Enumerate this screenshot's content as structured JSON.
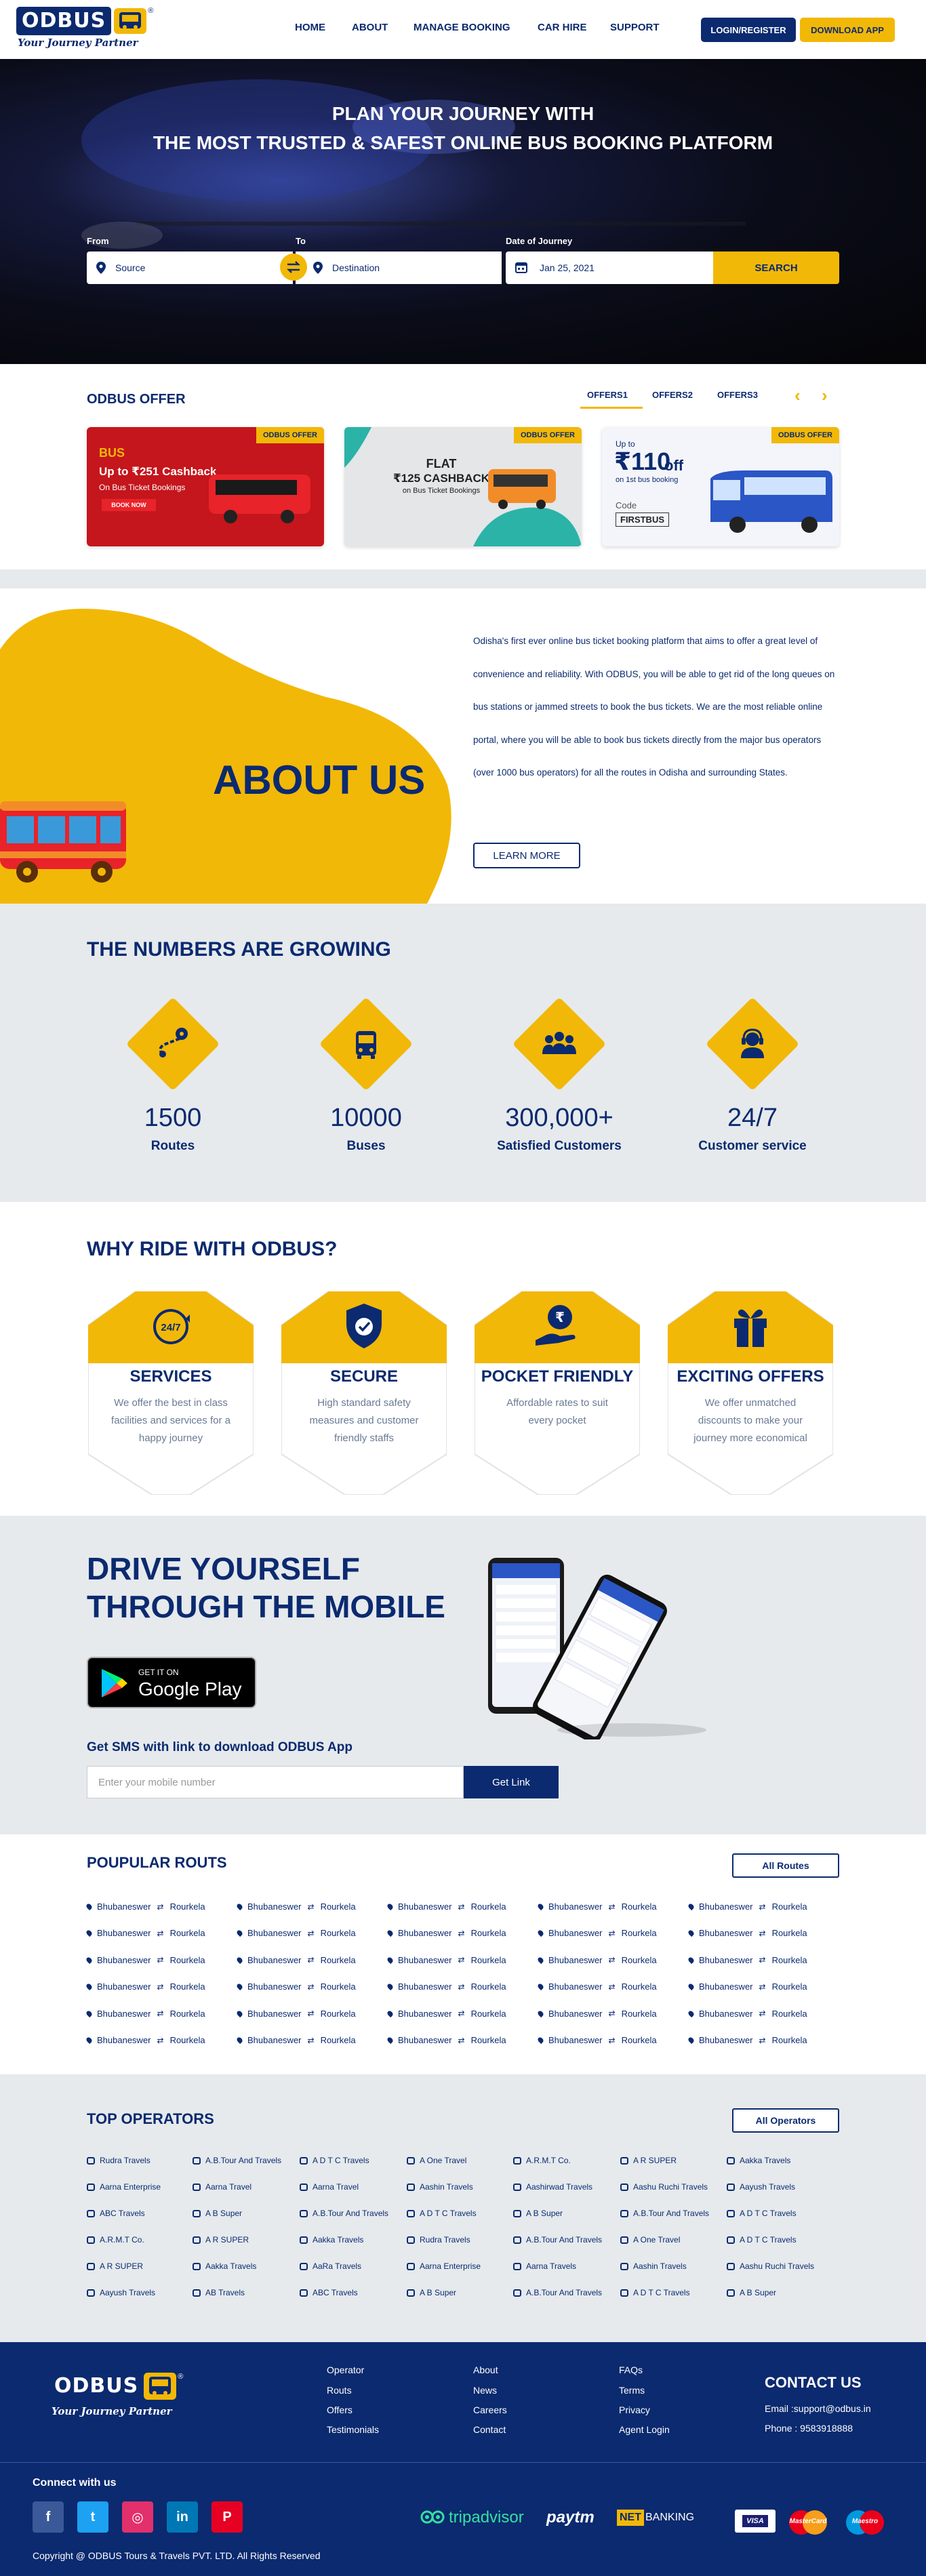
{
  "brand": {
    "logo": "ODBUS",
    "tagline": "Your Journey Partner",
    "reg": "®",
    "accent": "#f2b807",
    "navy": "#0b2a6f"
  },
  "nav": {
    "items": [
      "HOME",
      "ABOUT",
      "MANAGE BOOKING",
      "CAR HIRE",
      "SUPPORT"
    ],
    "login": "LOGIN/REGISTER",
    "download": "DOWNLOAD APP"
  },
  "hero": {
    "line1": "PLAN YOUR JOURNEY WITH",
    "line2": "THE MOST TRUSTED & SAFEST ONLINE BUS BOOKING PLATFORM",
    "from_label": "From",
    "to_label": "To",
    "date_label": "Date of Journey",
    "source_placeholder": "Source",
    "destination_placeholder": "Destination",
    "date_value": "Jan 25, 2021",
    "search": "SEARCH"
  },
  "offers": {
    "title": "ODBUS OFFER",
    "tabs": [
      "OFFERS1",
      "OFFERS2",
      "OFFERS3"
    ],
    "badge": "ODBUS OFFER",
    "card1": {
      "tag": "BUS",
      "headline": "Up to ₹251 Cashback",
      "sub": "On Bus Ticket Bookings",
      "cta": "BOOK NOW"
    },
    "card2": {
      "line1": "FLAT",
      "line2": "₹125 CASHBACK",
      "line3": "on Bus Ticket Bookings"
    },
    "card3": {
      "upto": "Up to",
      "amount": "₹110",
      "off": "off",
      "sub": "on 1st bus booking",
      "code_label": "Code",
      "code": "FIRSTBUS"
    }
  },
  "about": {
    "title": "ABOUT US",
    "text": "Odisha's first ever online bus ticket booking platform that aims to offer a great level of convenience and reliability. With ODBUS, you will be able to get rid of the long queues on bus stations or jammed streets to book the bus tickets. We are the most reliable online portal, where you will be able to book bus tickets directly from the major bus operators (over 1000 bus operators) for all the routes in Odisha and surrounding States.",
    "button": "LEARN MORE"
  },
  "numbers": {
    "title": "THE NUMBERS ARE GROWING",
    "items": [
      {
        "value": "1500",
        "label": "Routes",
        "icon": "route-icon"
      },
      {
        "value": "10000",
        "label": "Buses",
        "icon": "bus-icon"
      },
      {
        "value": "300,000+",
        "label": "Satisfied Customers",
        "icon": "customers-icon"
      },
      {
        "value": "24/7",
        "label": "Customer service",
        "icon": "support-agent-icon"
      }
    ]
  },
  "why": {
    "title": "WHY RIDE WITH ODBUS?",
    "items": [
      {
        "title": "SERVICES",
        "text": "We offer the best in class facilities and services for a happy journey",
        "icon": "24-7-icon",
        "glyph": "24/7"
      },
      {
        "title": "SECURE",
        "text": "High standard safety measures and customer friendly staffs",
        "icon": "shield-check-icon",
        "glyph": "✓"
      },
      {
        "title": "POCKET FRIENDLY",
        "text": "Affordable rates to suit every pocket",
        "icon": "rupee-hand-icon",
        "glyph": "₹"
      },
      {
        "title": "EXCITING OFFERS",
        "text": "We offer unmatched discounts to make your journey more economical",
        "icon": "gift-icon",
        "glyph": ""
      }
    ]
  },
  "mobile": {
    "line1": "DRIVE YOURSELF",
    "line2": "THROUGH THE MOBILE",
    "gplay_small": "GET IT ON",
    "gplay_big": "Google Play",
    "sms_label": "Get SMS with link to download ODBUS App",
    "input_placeholder": "Enter your mobile number",
    "button": "Get Link"
  },
  "routes": {
    "title": "POUPULAR ROUTS",
    "button": "All Routes",
    "from": "Bhubaneswer",
    "to": "Rourkela",
    "arrow": "⇄",
    "rows": 6,
    "cols": 5
  },
  "operators": {
    "title": "TOP OPERATORS",
    "button": "All Operators",
    "grid": [
      [
        "Rudra Travels",
        "A.B.Tour And Travels",
        "A D T C Travels",
        "A One Travel",
        "A.R.M.T Co.",
        "A R SUPER",
        "Aakka Travels"
      ],
      [
        "Aarna Enterprise",
        "Aarna Travel",
        "Aarna Travel",
        "Aashin Travels",
        "Aashirwad Travels",
        "Aashu Ruchi Travels",
        "Aayush Travels"
      ],
      [
        "ABC Travels",
        "A B Super",
        "A.B.Tour And Travels",
        "A D T C Travels",
        "A B Super",
        "A.B.Tour And Travels",
        "A D T C Travels"
      ],
      [
        "A.R.M.T Co.",
        "A R SUPER",
        "Aakka Travels",
        "Rudra Travels",
        "A.B.Tour And Travels",
        "A One Travel",
        "A D T C Travels"
      ],
      [
        "A R SUPER",
        "Aakka Travels",
        "AaRa Travels",
        "Aarna Enterprise",
        "Aarna Travels",
        "Aashin Travels",
        "Aashu Ruchi Travels"
      ],
      [
        "Aayush Travels",
        "AB Travels",
        "ABC Travels",
        "A B Super",
        "A.B.Tour And Travels",
        "A D T C Travels",
        "A B Super"
      ]
    ]
  },
  "footer": {
    "col1": [
      "Operator",
      "Routs",
      "Offers",
      "Testimonials"
    ],
    "col2": [
      "About",
      "News",
      "Careers",
      "Contact"
    ],
    "col3": [
      "FAQs",
      "Terms",
      "Privacy",
      "Agent Login"
    ],
    "contact_title": "CONTACT US",
    "email": "Email :support@odbus.in",
    "phone": "Phone : 9583918888",
    "connect": "Connect with us",
    "social": [
      {
        "icon": "facebook-icon",
        "glyph": "f",
        "color": "#3b5998"
      },
      {
        "icon": "twitter-icon",
        "glyph": "t",
        "color": "#1da1f2"
      },
      {
        "icon": "instagram-icon",
        "glyph": "◎",
        "color": "#e1306c"
      },
      {
        "icon": "linkedin-icon",
        "glyph": "in",
        "color": "#0077b5"
      },
      {
        "icon": "pinterest-icon",
        "glyph": "P",
        "color": "#e60023"
      }
    ],
    "partners": {
      "tripadvisor": "tripadvisor",
      "paytm": "paytm",
      "net": "NET",
      "banking": "BANKING",
      "visa": "VISA",
      "mastercard": "MasterCard",
      "maestro": "Maestro"
    },
    "copyright": "Copyright @ ODBUS Tours & Travels PVT. LTD. All Rights Reserved"
  }
}
